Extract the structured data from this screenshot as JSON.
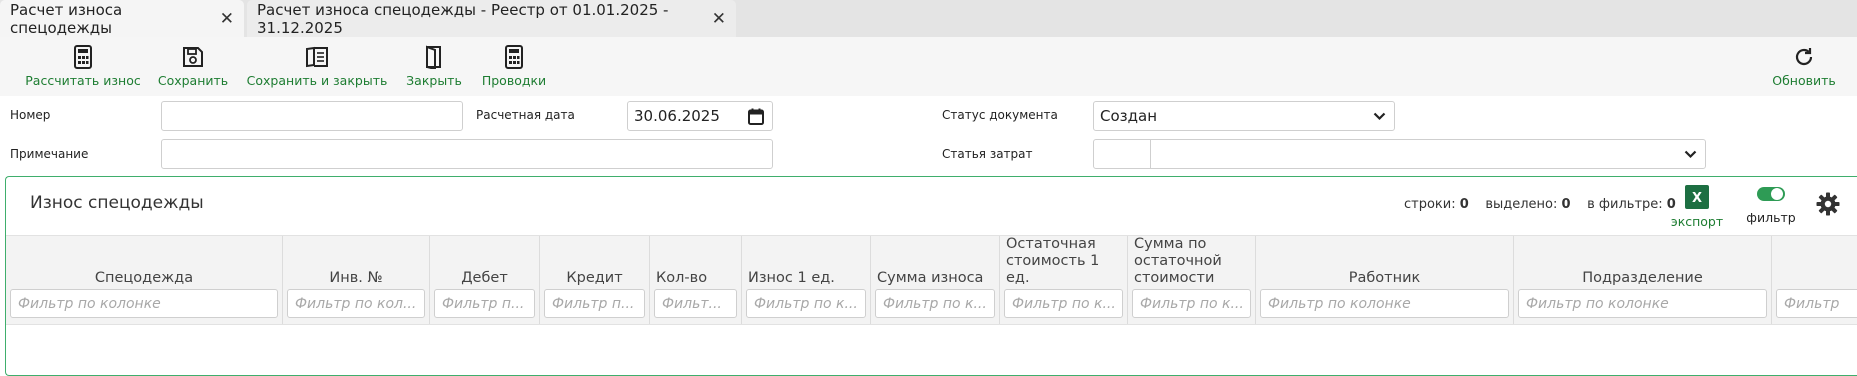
{
  "tabs": [
    {
      "label": "Расчет износа спецодежды",
      "active": true
    },
    {
      "label": "Расчет износа спецодежды - Реестр от 01.01.2025 - 31.12.2025",
      "active": false
    }
  ],
  "toolbar": {
    "calculate": "Рассчитать износ",
    "save": "Сохранить",
    "save_close": "Сохранить и закрыть",
    "close": "Закрыть",
    "postings": "Проводки",
    "refresh": "Обновить"
  },
  "form": {
    "number_label": "Номер",
    "number_value": "",
    "calc_date_label": "Расчетная дата",
    "calc_date_value": "30.06.2025",
    "status_label": "Статус документа",
    "status_value": "Создан",
    "note_label": "Примечание",
    "note_value": "",
    "cost_item_label": "Статья затрат",
    "cost_item_code": "",
    "cost_item_value": ""
  },
  "grid": {
    "title": "Износ спецодежды",
    "rows_label": "строки:",
    "rows_count": "0",
    "selected_label": "выделено:",
    "selected_count": "0",
    "filtered_label": "в фильтре:",
    "filtered_count": "0",
    "export_label": "экспорт",
    "filter_label": "фильтр",
    "filter_toggle_on": true,
    "columns": [
      {
        "header": "Спецодежда",
        "filter_placeholder": "Фильтр по колонке"
      },
      {
        "header": "Инв. №",
        "filter_placeholder": "Фильтр по кол..."
      },
      {
        "header": "Дебет",
        "filter_placeholder": "Фильтр п..."
      },
      {
        "header": "Кредит",
        "filter_placeholder": "Фильтр п..."
      },
      {
        "header": "Кол-во",
        "filter_placeholder": "Фильт..."
      },
      {
        "header": "Износ 1 ед.",
        "filter_placeholder": "Фильтр по к..."
      },
      {
        "header": "Сумма износа",
        "filter_placeholder": "Фильтр по к..."
      },
      {
        "header": "Остаточная стоимость 1 ед.",
        "filter_placeholder": "Фильтр по к..."
      },
      {
        "header": "Сумма по остаточной стоимости",
        "filter_placeholder": "Фильтр по к..."
      },
      {
        "header": "Работник",
        "filter_placeholder": "Фильтр по колонке"
      },
      {
        "header": "Подразделение",
        "filter_placeholder": "Фильтр по колонке"
      },
      {
        "header": "",
        "filter_placeholder": "Фильтр"
      }
    ]
  },
  "colors": {
    "accent_green": "#1e7d32",
    "panel_border": "#3fae6c",
    "excel_green": "#1d6f42",
    "toggle_green": "#2e9b55"
  },
  "icons": {
    "calculate": "calculator-icon",
    "save": "floppy-disk-icon",
    "save_close": "book-open-icon",
    "close": "door-icon",
    "postings": "calculator-icon",
    "refresh": "refresh-icon",
    "calendar": "calendar-icon",
    "chevron": "chevron-down-icon",
    "settings": "gear-icon",
    "excel": "excel-icon"
  }
}
